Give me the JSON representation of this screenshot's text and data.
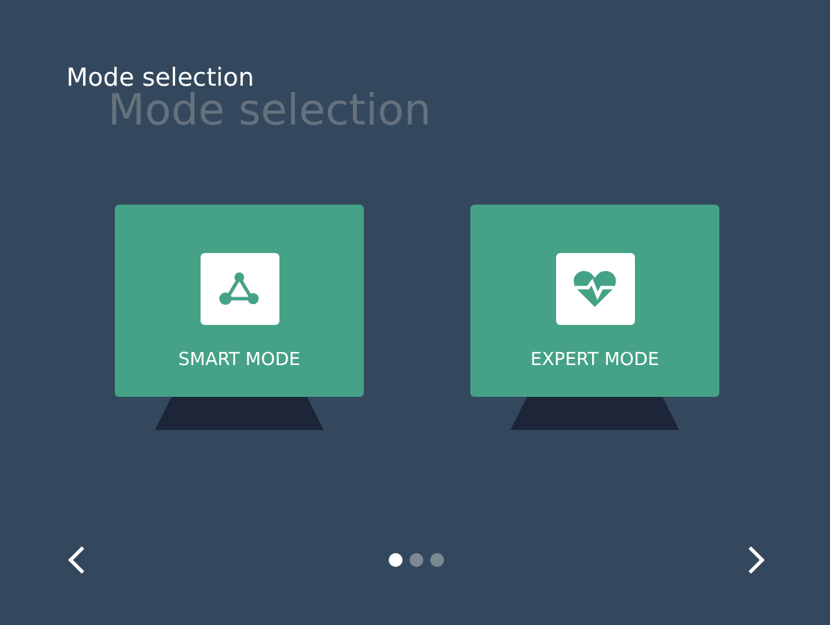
{
  "title": "Mode selection",
  "title_shadow": "Mode selection",
  "modes": [
    {
      "label": "SMART MODE",
      "kind": "network"
    },
    {
      "label": "EXPERT MODE",
      "kind": "heartbeat"
    }
  ],
  "pager": [
    {
      "selected": true
    },
    {
      "selected": false
    },
    {
      "selected": false
    }
  ]
}
